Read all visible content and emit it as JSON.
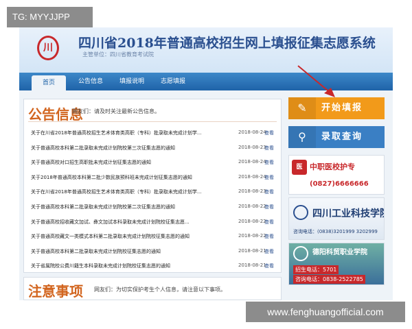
{
  "tag": {
    "text": "TG: MYYJJPP"
  },
  "watermark": {
    "text": "www.fenghuangofficial.com"
  },
  "header": {
    "title": "四川省2018年普通高校招生网上填报征集志愿系统",
    "subtitle": "主管单位：四川省教育考试院"
  },
  "nav": [
    {
      "label": "首页"
    },
    {
      "label": "公告信息"
    },
    {
      "label": "填报说明"
    },
    {
      "label": "志愿填报"
    }
  ],
  "notice": {
    "heading": "公告信息",
    "note": "网友们：请及时关注最新公告信息。",
    "items": [
      {
        "title": "关于在川省2018年普通高校招生艺术体育类高职（专科）批录取未完成计划学...",
        "date": "2018-08-24",
        "view": "查看"
      },
      {
        "title": "关于普通高校本科第二批录取未完成计划院校第三次征集志愿的通知",
        "date": "2018-08-23",
        "view": "查看"
      },
      {
        "title": "关于普通高校对口招生高职批未完成计划征集志愿的通知",
        "date": "2018-08-24",
        "view": "查看"
      },
      {
        "title": "关于2018年普通高校本科第二批少数民族预科班未完成计划征集志愿的通知",
        "date": "2018-08-24",
        "view": "查看"
      },
      {
        "title": "关于在川省2018年普通高校招生艺术体育类高职（专科）批录取未完成计划学...",
        "date": "2018-08-23",
        "view": "查看"
      },
      {
        "title": "关于普通高校本科第二批录取未完成计划院校第二次征集志愿的通知",
        "date": "2018-08-22",
        "view": "查看"
      },
      {
        "title": "关于普通高校招收藏文加试、彝文加试本科录取未完成计划院校征集志愿...",
        "date": "2018-08-22",
        "view": "查看"
      },
      {
        "title": "关于普通高校藏文一类模式本科第二批录取未完成计划院校征集志愿的通知",
        "date": "2018-08-22",
        "view": "查看"
      },
      {
        "title": "关于普通高校本科第二批录取未完成计划院校征集志愿的通知",
        "date": "2018-08-21",
        "view": "查看"
      },
      {
        "title": "关于省属院校公费川籍生本科录取未完成计划院校征集志愿的通知",
        "date": "2018-08-21",
        "view": "查看"
      }
    ]
  },
  "caution": {
    "heading": "注意事项",
    "note": "网友们：为切实保护考生个人信息，请注意以下事项。"
  },
  "actions": {
    "apply_label": "开始填报",
    "query_label": "录取查询"
  },
  "ads": {
    "ad1_badge": "医",
    "ad1_name": "中职医校护专",
    "ad1_phone": "(0827)6666666",
    "ad2_name": "四川工业科技学院",
    "ad2_phone": "咨询电话：(0838)3201999 3202999",
    "ad3_name": "德阳科贸职业学院",
    "ad3_line1": "招生电话：5701",
    "ad3_line2": "咨询电话：0838-2522785"
  },
  "colors": {
    "nav": "#1f63a8",
    "accent_orange": "#f29a1a",
    "accent_blue": "#3a7fc4",
    "heading": "#d2651f"
  },
  "icons": {
    "apply": "pencil-icon",
    "query": "magnifier-icon",
    "logo": "emblem-logo"
  }
}
